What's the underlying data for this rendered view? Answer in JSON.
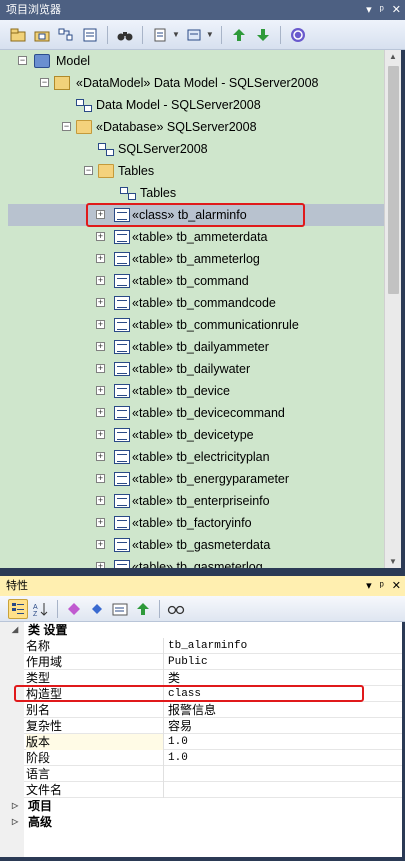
{
  "browser": {
    "title": "项目浏览器",
    "controls": [
      "▾",
      "ᵖ",
      "✕"
    ],
    "toolbar_icons": [
      "new-package-icon",
      "new-diagram-icon",
      "new-element-icon",
      "new-child-icon",
      "binoculars-icon",
      "document-icon",
      "settings-icon",
      "move-up-icon",
      "move-down-icon",
      "help-icon"
    ],
    "tree": [
      {
        "label": "Model",
        "expander": "−",
        "icon": "model"
      },
      {
        "label": "«DataModel» Data Model - SQLServer2008",
        "expander": "−",
        "icon": "pkg"
      },
      {
        "label": "Data Model - SQLServer2008",
        "expander": "",
        "icon": "diagram"
      },
      {
        "label": "«Database» SQLServer2008",
        "expander": "−",
        "icon": "folder"
      },
      {
        "label": "SQLServer2008",
        "expander": "",
        "icon": "diagram"
      },
      {
        "label": "Tables",
        "expander": "−",
        "icon": "folder"
      },
      {
        "label": "Tables",
        "expander": "",
        "icon": "diagram"
      },
      {
        "label": "«class» tb_alarminfo",
        "expander": "+",
        "icon": "table",
        "selected": true
      },
      {
        "label": "«table» tb_ammeterdata",
        "expander": "+",
        "icon": "table"
      },
      {
        "label": "«table» tb_ammeterlog",
        "expander": "+",
        "icon": "table"
      },
      {
        "label": "«table» tb_command",
        "expander": "+",
        "icon": "table"
      },
      {
        "label": "«table» tb_commandcode",
        "expander": "+",
        "icon": "table"
      },
      {
        "label": "«table» tb_communicationrule",
        "expander": "+",
        "icon": "table"
      },
      {
        "label": "«table» tb_dailyammeter",
        "expander": "+",
        "icon": "table"
      },
      {
        "label": "«table» tb_dailywater",
        "expander": "+",
        "icon": "table"
      },
      {
        "label": "«table» tb_device",
        "expander": "+",
        "icon": "table"
      },
      {
        "label": "«table» tb_devicecommand",
        "expander": "+",
        "icon": "table"
      },
      {
        "label": "«table» tb_devicetype",
        "expander": "+",
        "icon": "table"
      },
      {
        "label": "«table» tb_electricityplan",
        "expander": "+",
        "icon": "table"
      },
      {
        "label": "«table» tb_energyparameter",
        "expander": "+",
        "icon": "table"
      },
      {
        "label": "«table» tb_enterpriseinfo",
        "expander": "+",
        "icon": "table"
      },
      {
        "label": "«table» tb_factoryinfo",
        "expander": "+",
        "icon": "table"
      },
      {
        "label": "«table» tb_gasmeterdata",
        "expander": "+",
        "icon": "table"
      },
      {
        "label": "«table» tb_gasmeterlog",
        "expander": "+",
        "icon": "table"
      }
    ]
  },
  "properties": {
    "title": "特性",
    "controls": [
      "▾",
      "ᵖ",
      "✕"
    ],
    "toolbar_icons": [
      "categorized-icon",
      "alphabetical-icon",
      "tag-icon",
      "tag-blue-icon",
      "properties-icon",
      "up-arrow-icon",
      "glasses-icon"
    ],
    "category_main": "类 设置",
    "rows": [
      {
        "name": "名称",
        "value": "tb_alarminfo",
        "cjk": false
      },
      {
        "name": "作用域",
        "value": "Public",
        "cjk": false
      },
      {
        "name": "类型",
        "value": "类",
        "cjk": true
      },
      {
        "name": "构造型",
        "value": "class",
        "cjk": false
      },
      {
        "name": "别名",
        "value": "报警信息",
        "cjk": true
      },
      {
        "name": "复杂性",
        "value": "容易",
        "cjk": true
      },
      {
        "name": "版本",
        "value": "1.0",
        "cjk": false,
        "editable": true
      },
      {
        "name": "阶段",
        "value": "1.0",
        "cjk": false
      },
      {
        "name": "语言",
        "value": "",
        "cjk": false
      },
      {
        "name": "文件名",
        "value": "",
        "cjk": false
      }
    ],
    "category_project": "项目",
    "category_advanced": "高级"
  }
}
